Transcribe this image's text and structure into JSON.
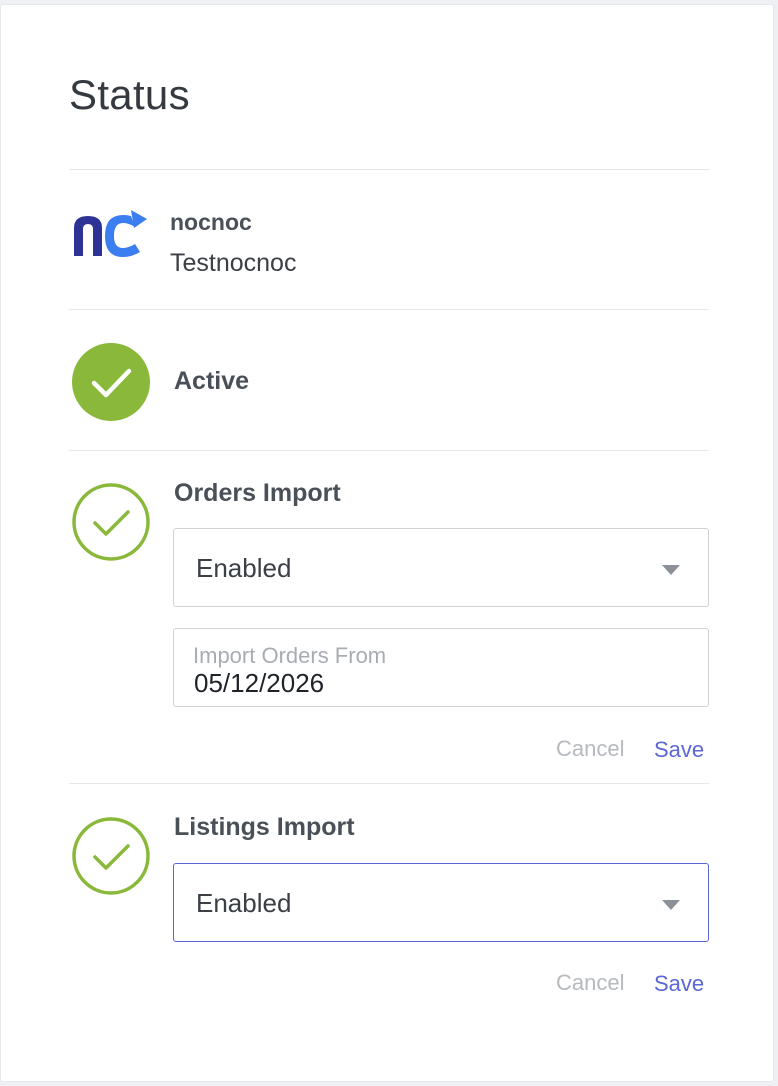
{
  "panel": {
    "title": "Status"
  },
  "store": {
    "logo_icon": "nocnoc-logo-icon",
    "name": "nocnoc",
    "account": "Testnocnoc"
  },
  "active": {
    "icon": "check-circle-filled-icon",
    "label": "Active"
  },
  "orders_import": {
    "icon": "check-circle-outline-icon",
    "label": "Orders Import",
    "select_value": "Enabled",
    "date_label": "Import Orders From",
    "date_value": "05/12/2026",
    "cancel_label": "Cancel",
    "save_label": "Save"
  },
  "listings_import": {
    "icon": "check-circle-outline-icon",
    "label": "Listings Import",
    "select_value": "Enabled",
    "cancel_label": "Cancel",
    "save_label": "Save"
  },
  "colors": {
    "accent": "#5b67d4",
    "success": "#8ab83a",
    "logo_dark": "#2d3394",
    "logo_light": "#3a7ef0"
  }
}
